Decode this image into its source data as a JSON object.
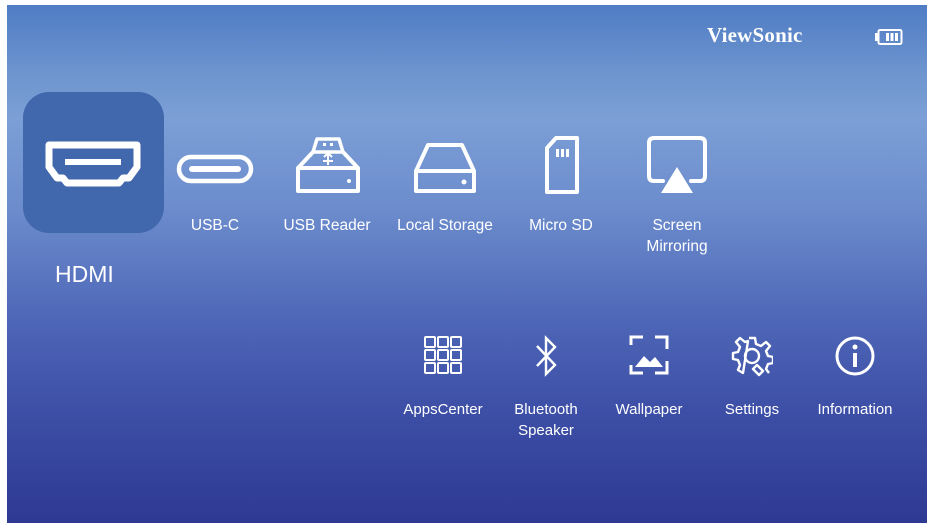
{
  "header": {
    "brand": "ViewSonic",
    "battery_icon": "battery-icon"
  },
  "sources": [
    {
      "label": "HDMI",
      "icon": "hdmi-icon",
      "selected": true
    },
    {
      "label": "USB-C",
      "icon": "usb-c-icon"
    },
    {
      "label": "USB Reader",
      "icon": "usb-reader-icon"
    },
    {
      "label": "Local Storage",
      "icon": "local-storage-icon"
    },
    {
      "label": "Micro SD",
      "icon": "micro-sd-icon"
    },
    {
      "label": "Screen\nMirroring",
      "icon": "screen-mirroring-icon"
    }
  ],
  "apps": [
    {
      "label": "AppsCenter",
      "icon": "apps-grid-icon"
    },
    {
      "label": "Bluetooth\nSpeaker",
      "icon": "bluetooth-icon"
    },
    {
      "label": "Wallpaper",
      "icon": "wallpaper-icon"
    },
    {
      "label": "Settings",
      "icon": "settings-gear-icon"
    },
    {
      "label": "Information",
      "icon": "info-icon"
    }
  ]
}
